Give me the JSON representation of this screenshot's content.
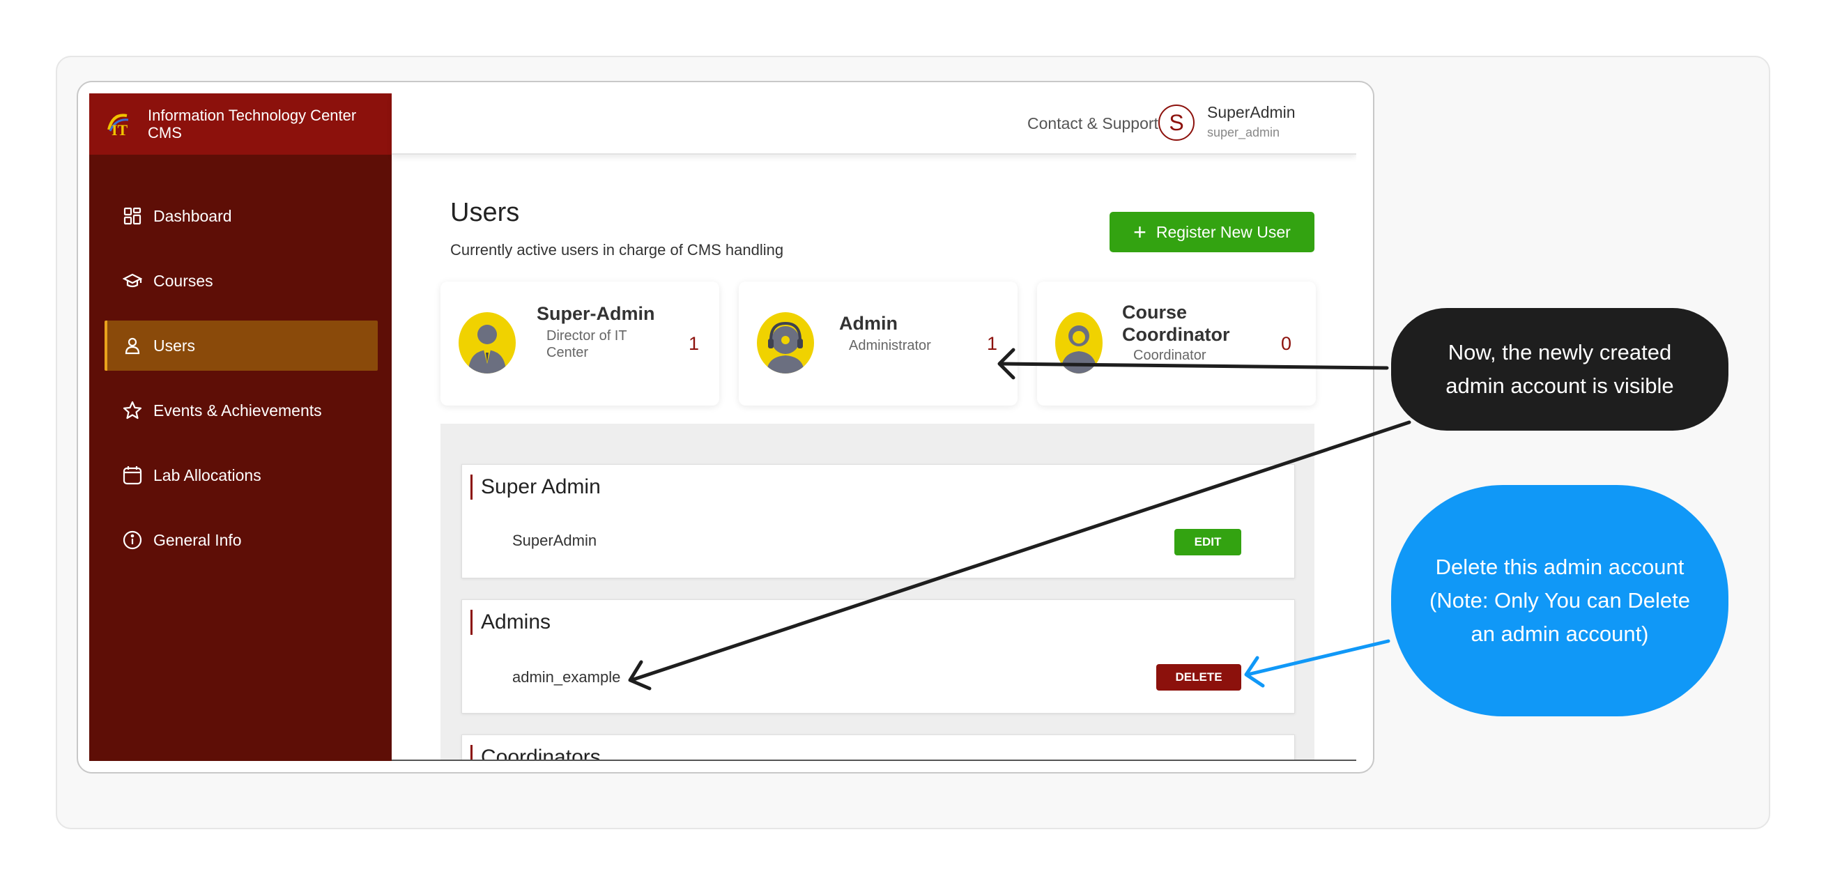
{
  "brand": {
    "line1": "Information Technology Center",
    "line2": "CMS"
  },
  "header": {
    "contact": "Contact & Support",
    "avatar_letter": "S",
    "user_name": "SuperAdmin",
    "user_handle": "super_admin"
  },
  "sidebar": {
    "items": [
      {
        "label": "Dashboard",
        "icon": "dashboard-icon"
      },
      {
        "label": "Courses",
        "icon": "graduation-cap-icon"
      },
      {
        "label": "Users",
        "icon": "user-icon",
        "active": true
      },
      {
        "label": "Events & Achievements",
        "icon": "star-icon"
      },
      {
        "label": "Lab Allocations",
        "icon": "calendar-icon"
      },
      {
        "label": "General Info",
        "icon": "info-icon"
      }
    ]
  },
  "main": {
    "title": "Users",
    "subtitle": "Currently active users in charge of CMS handling",
    "register_label": "Register New User",
    "stats": [
      {
        "title": "Super-Admin",
        "sub_line1": "Director of IT",
        "sub_line2": "Center",
        "count": "1"
      },
      {
        "title": "Admin",
        "sub": "Administrator",
        "count": "1"
      },
      {
        "title_line1": "Course",
        "title_line2": "Coordinator",
        "sub": "Coordinator",
        "count": "0"
      }
    ],
    "groups": {
      "super_admin": {
        "title": "Super Admin",
        "user": "SuperAdmin",
        "action": "EDIT"
      },
      "admins": {
        "title": "Admins",
        "user": "admin_example",
        "action": "DELETE"
      },
      "coordinators": {
        "title": "Coordinators"
      }
    }
  },
  "callouts": {
    "dark": {
      "line1": "Now, the newly created",
      "line2": "admin account is visible"
    },
    "blue": {
      "line1": "Delete this admin account",
      "line2": "(Note: Only You can Delete",
      "line3": "an admin account)"
    }
  },
  "colors": {
    "primary_red": "#8c110c",
    "sidebar_bg": "#5e0e06",
    "active_item": "#8a4a0a",
    "green": "#33a311",
    "callout_blue": "#1098f7",
    "callout_dark": "#1e1e1e"
  }
}
